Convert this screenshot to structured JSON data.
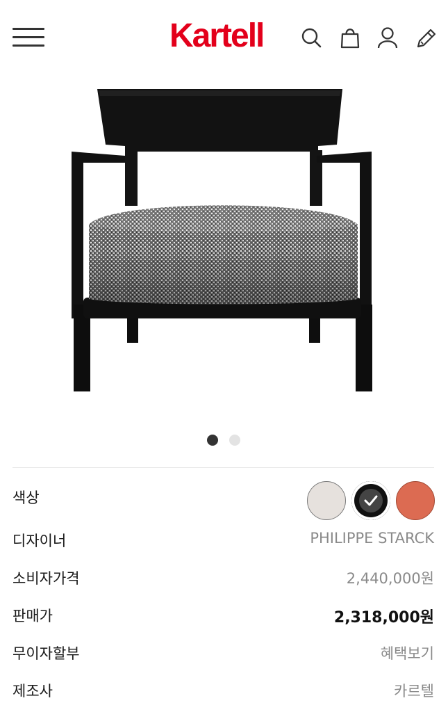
{
  "header": {
    "logo_text": "Kartell",
    "logo_color": "#e3001b",
    "icons": [
      "menu-icon",
      "search-icon",
      "shopping-bag-icon",
      "user-icon",
      "pen-icon"
    ]
  },
  "gallery": {
    "image_alt": "Cara armchair",
    "dot_count": 2,
    "active_dot": 1
  },
  "product_info": {
    "color": {
      "label": "색상",
      "swatches": [
        {
          "name": "light-grey",
          "hex": "#e6e1dd",
          "selected": false
        },
        {
          "name": "black",
          "hex": "#111111",
          "selected": true
        },
        {
          "name": "orange",
          "hex": "#dc6b52",
          "selected": false
        }
      ]
    },
    "designer": {
      "label": "디자이너",
      "value": "PHILIPPE STARCK"
    },
    "consumer_price": {
      "label": "소비자가격",
      "value": "2,440,000원"
    },
    "sale_price": {
      "label": "판매가",
      "value": "2,318,000원"
    },
    "installment": {
      "label": "무이자할부",
      "value": "혜택보기"
    },
    "manufacturer": {
      "label": "제조사",
      "value": "카르텔"
    }
  }
}
